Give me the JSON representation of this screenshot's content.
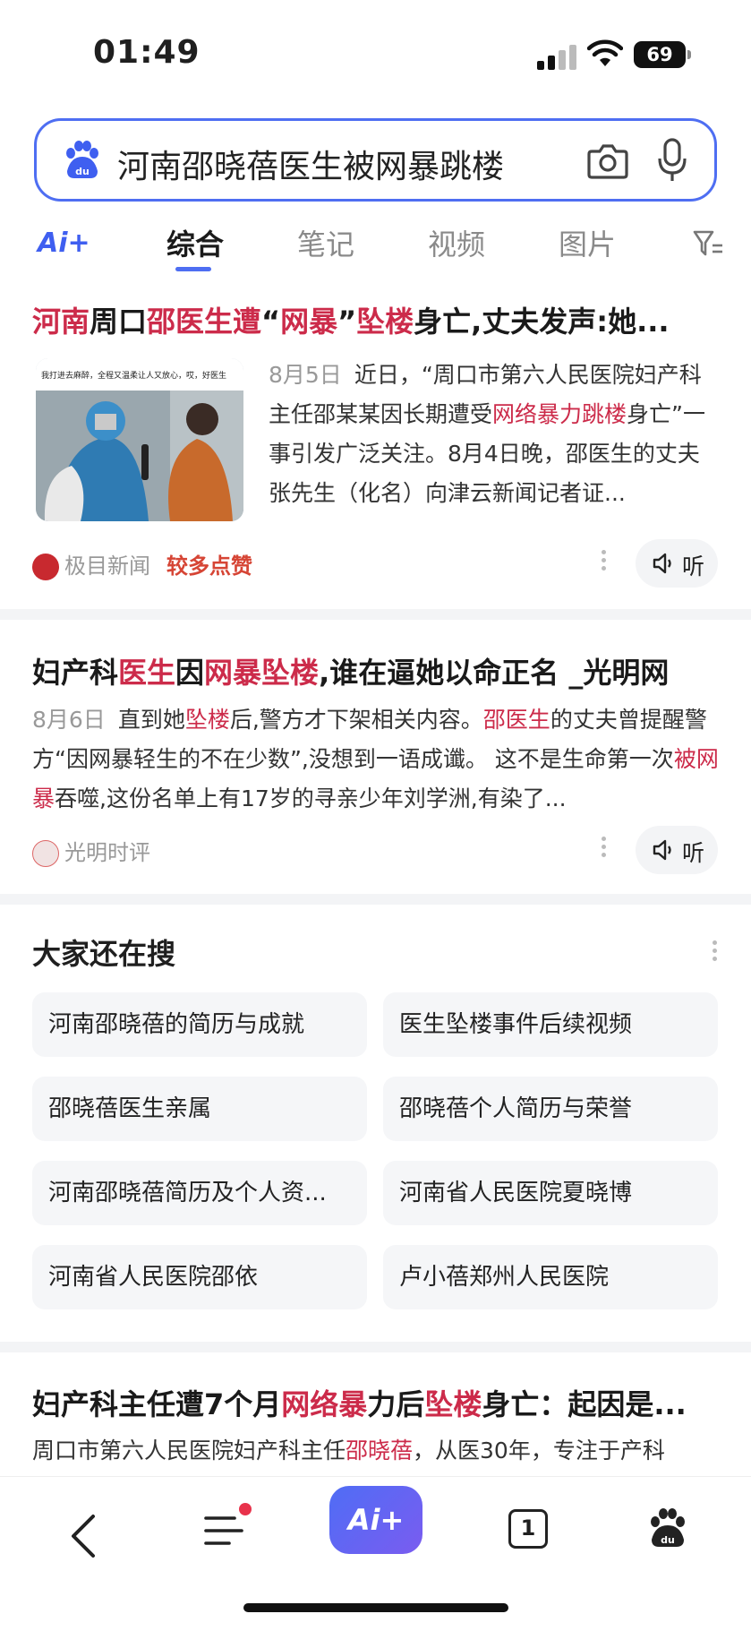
{
  "status_bar": {
    "time": "01:49",
    "battery": "69"
  },
  "search": {
    "query": "河南邵晓蓓医生被网暴跳楼"
  },
  "tabs": {
    "ai_label": "Ai+",
    "items": [
      "综合",
      "笔记",
      "视频",
      "图片"
    ]
  },
  "results": [
    {
      "title_parts": [
        {
          "t": "河南",
          "hl": true
        },
        {
          "t": "周口",
          "hl": false
        },
        {
          "t": "邵医生遭",
          "hl": true
        },
        {
          "t": "“",
          "hl": false
        },
        {
          "t": "网暴",
          "hl": true
        },
        {
          "t": "”",
          "hl": false
        },
        {
          "t": "坠楼",
          "hl": true
        },
        {
          "t": "身亡,丈夫发声:她...",
          "hl": false
        }
      ],
      "date": "8月5日",
      "snippet_parts": [
        {
          "t": "近日，“周口市第六人民医院妇产科主任邵某某因长期遭受",
          "hl": false
        },
        {
          "t": "网络暴力跳楼",
          "hl": true
        },
        {
          "t": "身亡”一事引发广泛关注。8月4日晚，邵医生的丈夫张先生（化名）向津云新闻记者证...",
          "hl": false
        }
      ],
      "thumb_caption": "我打进去麻醉，全程又温柔让人又放心，哎，好医生",
      "source": "极目新闻",
      "badge": "较多点赞",
      "listen_label": "听"
    },
    {
      "title_parts": [
        {
          "t": "妇产科",
          "hl": false
        },
        {
          "t": "医生",
          "hl": true
        },
        {
          "t": "因",
          "hl": false
        },
        {
          "t": "网暴坠楼",
          "hl": true
        },
        {
          "t": ",谁在逼她以命正名 _光明网",
          "hl": false
        }
      ],
      "date": "8月6日",
      "snippet_parts": [
        {
          "t": "直到她",
          "hl": false
        },
        {
          "t": "坠楼",
          "hl": true
        },
        {
          "t": "后,警方才下架相关内容。",
          "hl": false
        },
        {
          "t": "邵医生",
          "hl": true
        },
        {
          "t": "的丈夫曾提醒警方“因网暴轻生的不在少数”,没想到一语成谶。 这不是生命第一次",
          "hl": false
        },
        {
          "t": "被网暴",
          "hl": true
        },
        {
          "t": "吞噬,这份名单上有17岁的寻亲少年刘学洲,有染了...",
          "hl": false
        }
      ],
      "source": "光明时评",
      "listen_label": "听"
    },
    {
      "title_parts": [
        {
          "t": "妇产科主任遭7个月",
          "hl": false
        },
        {
          "t": "网络暴",
          "hl": true
        },
        {
          "t": "力后",
          "hl": false
        },
        {
          "t": "坠楼",
          "hl": true
        },
        {
          "t": "身亡：起因是...",
          "hl": false
        }
      ],
      "snippet_parts": [
        {
          "t": "周口市第六人民医院妇产科主任",
          "hl": false
        },
        {
          "t": "邵晓蓓",
          "hl": true
        },
        {
          "t": "，从医30年，专注于产科",
          "hl": false
        }
      ]
    }
  ],
  "related": {
    "title": "大家还在搜",
    "items": [
      "河南邵晓蓓的简历与成就",
      "医生坠楼事件后续视频",
      "邵晓蓓医生亲属",
      "邵晓蓓个人简历与荣誉",
      "河南邵晓蓓简历及个人资...",
      "河南省人民医院夏晓博",
      "河南省人民医院邵依",
      "卢小蓓郑州人民医院"
    ]
  },
  "bottom_nav": {
    "ai_label": "Ai+",
    "tab_count": "1"
  },
  "colors": {
    "accent": "#4e6ef2",
    "highlight": "#cc2b4a",
    "hot": "#d64535"
  }
}
